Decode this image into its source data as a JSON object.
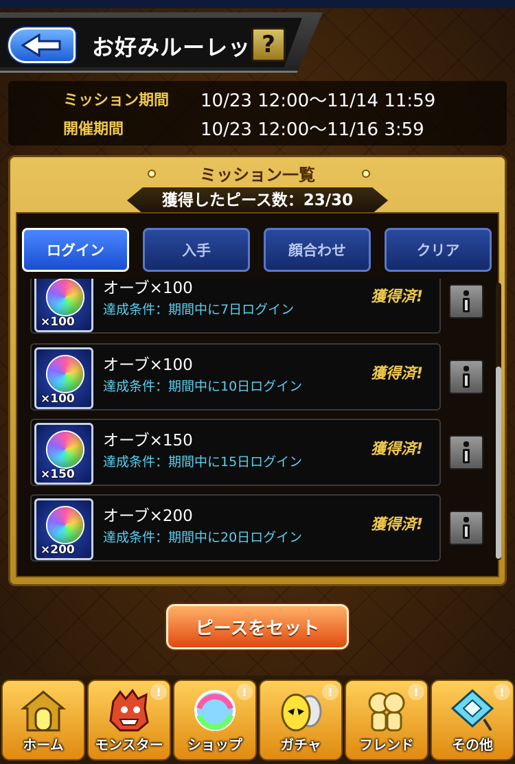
{
  "header": {
    "title": "お好みルーレット",
    "help_label": "?"
  },
  "period": {
    "mission_label": "ミッション期間",
    "mission_value": "10/23 12:00〜11/14 11:59",
    "event_label": "開催期間",
    "event_value": "10/23 12:00〜11/16 3:59"
  },
  "panel": {
    "title": "ミッション一覧",
    "pieces_text": "獲得したピース数：23/30"
  },
  "tabs": [
    {
      "label": "ログイン",
      "active": true
    },
    {
      "label": "入手",
      "active": false
    },
    {
      "label": "顔合わせ",
      "active": false
    },
    {
      "label": "クリア",
      "active": false
    }
  ],
  "missions": [
    {
      "reward": "オーブ×100",
      "count": "×100",
      "condition": "達成条件：期間中に7日ログイン",
      "status": "獲得済!"
    },
    {
      "reward": "オーブ×100",
      "count": "×100",
      "condition": "達成条件：期間中に10日ログイン",
      "status": "獲得済!"
    },
    {
      "reward": "オーブ×150",
      "count": "×150",
      "condition": "達成条件：期間中に15日ログイン",
      "status": "獲得済!"
    },
    {
      "reward": "オーブ×200",
      "count": "×200",
      "condition": "達成条件：期間中に20日ログイン",
      "status": "獲得済!"
    }
  ],
  "set_button": "ピースをセット",
  "nav": [
    {
      "label": "ホーム",
      "icon": "home-icon"
    },
    {
      "label": "モンスター",
      "icon": "monster-icon"
    },
    {
      "label": "ショップ",
      "icon": "orb-icon"
    },
    {
      "label": "ガチャ",
      "icon": "egg-icon"
    },
    {
      "label": "フレンド",
      "icon": "friend-icon"
    },
    {
      "label": "その他",
      "icon": "other-icon"
    }
  ],
  "nav_badge": "!",
  "colors": {
    "accent_gold": "#f0c94a",
    "condition_cyan": "#5ad0f0",
    "tab_active": "#1a4ed0",
    "button_orange": "#e04a10"
  }
}
